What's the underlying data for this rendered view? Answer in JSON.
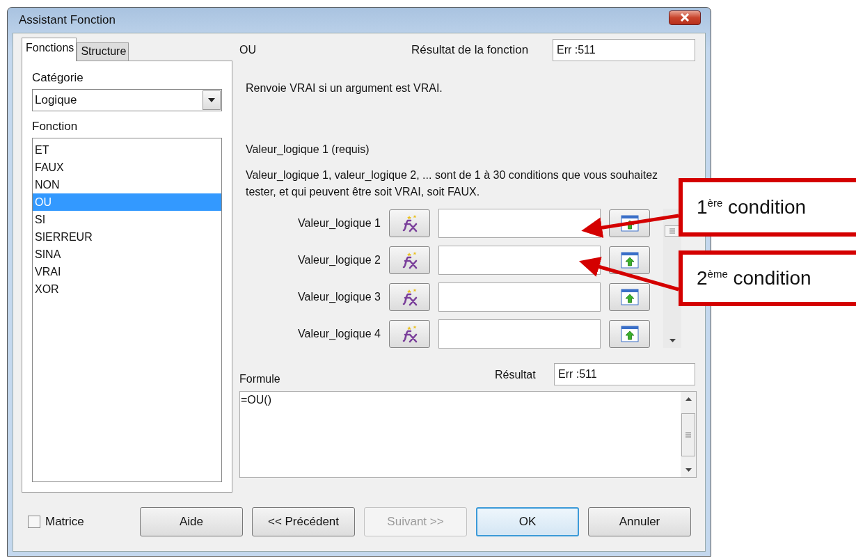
{
  "window": {
    "title": "Assistant Fonction"
  },
  "tabs": [
    {
      "label": "Fonctions",
      "selected": true
    },
    {
      "label": "Structure",
      "selected": false
    }
  ],
  "category": {
    "label": "Catégorie",
    "value": "Logique"
  },
  "function_list": {
    "label": "Fonction",
    "items": [
      {
        "label": "ET",
        "selected": false
      },
      {
        "label": "FAUX",
        "selected": false
      },
      {
        "label": "NON",
        "selected": false
      },
      {
        "label": "OU",
        "selected": true
      },
      {
        "label": "SI",
        "selected": false
      },
      {
        "label": "SIERREUR",
        "selected": false
      },
      {
        "label": "SINA",
        "selected": false
      },
      {
        "label": "VRAI",
        "selected": false
      },
      {
        "label": "XOR",
        "selected": false
      }
    ]
  },
  "function_name": "OU",
  "function_result": {
    "label": "Résultat de la fonction",
    "value": "Err :511"
  },
  "description": "Renvoie VRAI si un argument est VRAI.",
  "argument_title": "Valeur_logique 1 (requis)",
  "argument_help": "Valeur_logique 1, valeur_logique 2, ... sont de 1 à 30 conditions que vous souhaitez tester, et qui peuvent être soit VRAI, soit FAUX.",
  "arguments": [
    {
      "label": "Valeur_logique 1"
    },
    {
      "label": "Valeur_logique 2"
    },
    {
      "label": "Valeur_logique 3"
    },
    {
      "label": "Valeur_logique 4"
    }
  ],
  "formula": {
    "label": "Formule",
    "value": "=OU()"
  },
  "result": {
    "label": "Résultat",
    "value": "Err :511"
  },
  "matrix": {
    "label": "Matrice",
    "checked": false
  },
  "buttons": [
    {
      "label": "Aide",
      "disabled": false,
      "default": false
    },
    {
      "label": "<< Précédent",
      "disabled": false,
      "default": false
    },
    {
      "label": "Suivant >>",
      "disabled": true,
      "default": false
    },
    {
      "label": "OK",
      "disabled": false,
      "default": true
    },
    {
      "label": "Annuler",
      "disabled": false,
      "default": false
    }
  ],
  "callouts": [
    {
      "text": "1$^{ère}$ condition"
    },
    {
      "text": "2$^{ème}$ condition"
    }
  ]
}
